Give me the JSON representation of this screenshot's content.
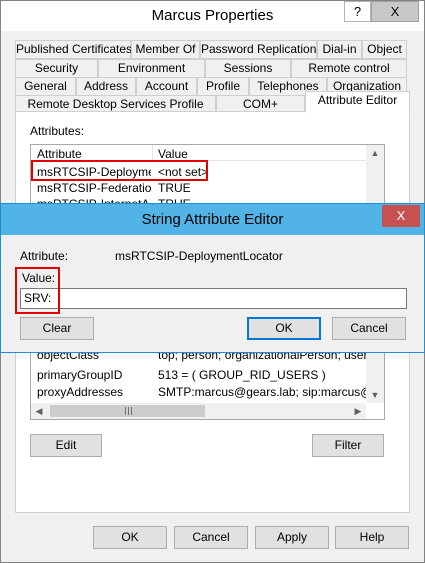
{
  "window": {
    "title": "Marcus Properties",
    "help_glyph": "?",
    "close_glyph": "X"
  },
  "tabs": {
    "row1": [
      "Published Certificates",
      "Member Of",
      "Password Replication",
      "Dial-in",
      "Object"
    ],
    "row2": [
      "Security",
      "Environment",
      "Sessions",
      "Remote control"
    ],
    "row3": [
      "General",
      "Address",
      "Account",
      "Profile",
      "Telephones",
      "Organization"
    ],
    "row4": [
      "Remote Desktop Services Profile",
      "COM+",
      "Attribute Editor"
    ]
  },
  "attributes": {
    "label": "Attributes:",
    "col_attribute": "Attribute",
    "col_value": "Value",
    "rows_top": [
      {
        "attr": "msRTCSIP-Deployme...",
        "value": "<not set>"
      },
      {
        "attr": "msRTCSIP-Federatio...",
        "value": "TRUE"
      },
      {
        "attr": "msRTCSIP-InternetA...",
        "value": "TRUE"
      }
    ],
    "rows_bottom": [
      {
        "attr": "objectClass",
        "value": "top; person; organizationalPerson; user"
      },
      {
        "attr": "primaryGroupID",
        "value": "513 = ( GROUP_RID_USERS )"
      },
      {
        "attr": "proxyAddresses",
        "value": "SMTP:marcus@gears.lab; sip:marcus@gears"
      }
    ],
    "edit_label": "Edit",
    "filter_label": "Filter"
  },
  "footer": {
    "ok": "OK",
    "cancel": "Cancel",
    "apply": "Apply",
    "help": "Help"
  },
  "dialog": {
    "title": "String Attribute Editor",
    "close_glyph": "X",
    "attribute_label": "Attribute:",
    "attribute_value": "msRTCSIP-DeploymentLocator",
    "value_label": "Value:",
    "value_text": "SRV:",
    "clear": "Clear",
    "ok": "OK",
    "cancel": "Cancel"
  },
  "colors": {
    "highlight": "#e00000",
    "dialog_title": "#52b3e6",
    "default_button": "#0078d7"
  }
}
